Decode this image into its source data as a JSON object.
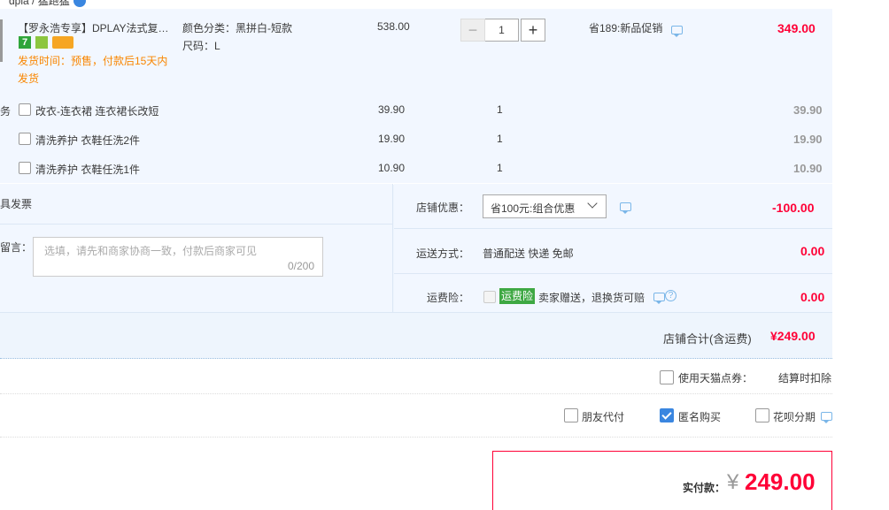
{
  "top_link": "dpla / 猛跑猛",
  "item": {
    "title": "【罗永浩专享】DPLAY法式复…",
    "attr_color": "颜色分类：黑拼白-短款",
    "attr_size": "尺码：L",
    "price": "538.00",
    "qty": "1",
    "promo": "省189:新品促销",
    "subtotal": "349.00",
    "ship_time": "发货时间：预售，付款后15天内",
    "ship_time2": "发货",
    "badge_seven": "7"
  },
  "services": {
    "label": "务",
    "rows": [
      {
        "name": "改衣-连衣裙 连衣裙长改短",
        "price": "39.90",
        "qty": "1",
        "total": "39.90"
      },
      {
        "name": "清洗养护 衣鞋任洗2件",
        "price": "19.90",
        "qty": "1",
        "total": "19.90"
      },
      {
        "name": "清洗养护 衣鞋任洗1件",
        "price": "10.90",
        "qty": "1",
        "total": "10.90"
      }
    ]
  },
  "invoice": "具发票",
  "message": {
    "label": "留言：",
    "placeholder": "选填，请先和商家协商一致，付款后商家可见",
    "counter": "0/200"
  },
  "store_discount": {
    "label": "店铺优惠：",
    "select": "省100元:组合优惠",
    "amount": "-100.00"
  },
  "shipping": {
    "label": "运送方式：",
    "value": "普通配送 快递 免邮",
    "amount": "0.00"
  },
  "insurance": {
    "label": "运费险：",
    "tag": "运费险",
    "value": "卖家赠送，退换货可赔",
    "amount": "0.00"
  },
  "store_total": {
    "label": "店铺合计(含运费)",
    "amount": "¥249.00"
  },
  "tmall_points": {
    "label": "使用天猫点券：",
    "note": "结算时扣除"
  },
  "options": {
    "friend_pay": "朋友代付",
    "anonymous": "匿名购买",
    "huabei": "花呗分期"
  },
  "payment": {
    "label": "实付款：",
    "currency": "¥",
    "amount": "249.00"
  },
  "colors": {
    "accent_red": "#ff0036",
    "light_blue_bg": "#f2f7ff",
    "ship_orange": "#f98600",
    "tag_green": "#3ea843",
    "checkbox_blue": "#3a86e0"
  }
}
